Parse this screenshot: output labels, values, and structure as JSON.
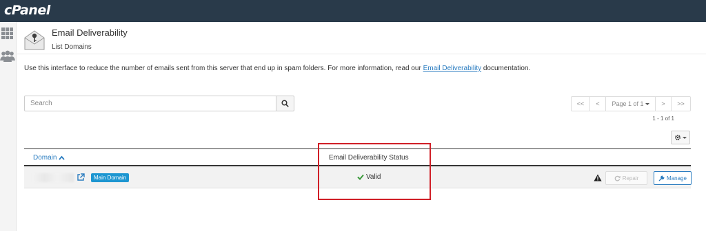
{
  "topbar": {
    "logo": "cPanel"
  },
  "sidebar": {
    "items": [
      {
        "icon": "grid-icon"
      },
      {
        "icon": "users-icon"
      }
    ]
  },
  "header": {
    "icon": "envelope-key-icon",
    "title": "Email Deliverability",
    "subtitle": "List Domains"
  },
  "description": {
    "text": "Use this interface to reduce the number of emails sent from this server that end up in spam folders. For more information, read our ",
    "link": "Email Deliverability",
    "suffix": " documentation."
  },
  "search": {
    "placeholder": "Search",
    "value": ""
  },
  "pagination": {
    "first": "<<",
    "prev": "<",
    "page_label": "Page 1 of 1",
    "next": ">",
    "last": ">>",
    "range": "1 - 1 of 1"
  },
  "table": {
    "columns": {
      "domain": "Domain",
      "status": "Email Deliverability Status"
    },
    "rows": [
      {
        "domain": "",
        "badge": "Main Domain",
        "status": "Valid",
        "repair_label": "Repair",
        "manage_label": "Manage"
      }
    ]
  },
  "colors": {
    "topbar": "#293a4a",
    "link": "#2a7cc0",
    "badge": "#1d96d1",
    "valid": "#3c9a3c",
    "highlight": "#d01f27"
  }
}
